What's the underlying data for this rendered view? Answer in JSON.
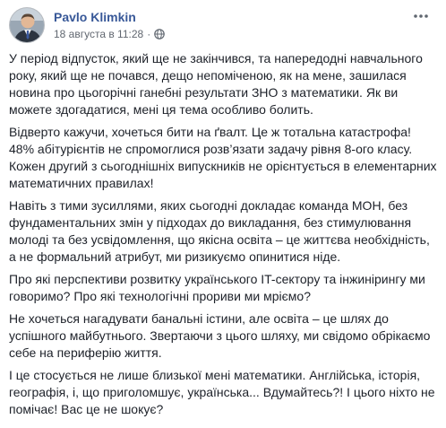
{
  "post": {
    "author": "Pavlo Klimkin",
    "timestamp": "18 августа в 11:28",
    "separator": "·",
    "privacy_icon": "globe-icon",
    "more_icon": "more-dots-icon",
    "link_color": "#385898",
    "text_color": "#1d2129",
    "meta_color": "#616770",
    "paragraphs": [
      "У період відпусток, який ще не закінчився, та напередодні навчального року, який ще не почався, дещо непоміченою, як на мене, зашилася новина про цьогорічні ганебні результати ЗНО з математики. Як ви можете здогадатися, мені ця тема особливо болить.",
      "Відверто кажучи, хочеться бити на ґвалт. Це ж тотальна катастрофа! 48% абітурієнтів не спромоглися розв’язати задачу рівня 8-ого класу. Кожен другий з сьогоднішніх випускників не орієнтується в елементарних математичних правилах!",
      "Навіть з тими зусиллями, яких сьогодні докладає команда МОН, без фундаментальних змін у підходах до викладання, без стимулювання молоді та без усвідомлення, що якісна освіта – це життєва необхідність, а не формальний атрибут, ми ризикуємо опинитися ніде.",
      "Про які перспективи розвитку українського IT-сектору та інжинірингу ми говоримо? Про які технологічні прориви ми мріємо?",
      "Не хочеться нагадувати банальні істини, але освіта – це шлях до успішного майбутнього. Звертаючи з цього шляху, ми свідомо обрікаємо себе на периферію життя.",
      "І це стосується не лише близької мені математики. Англійська, історія, географія, і, що приголомшує, українська... Вдумайтесь?! І цього ніхто не помічає! Вас це не шокує?"
    ]
  }
}
